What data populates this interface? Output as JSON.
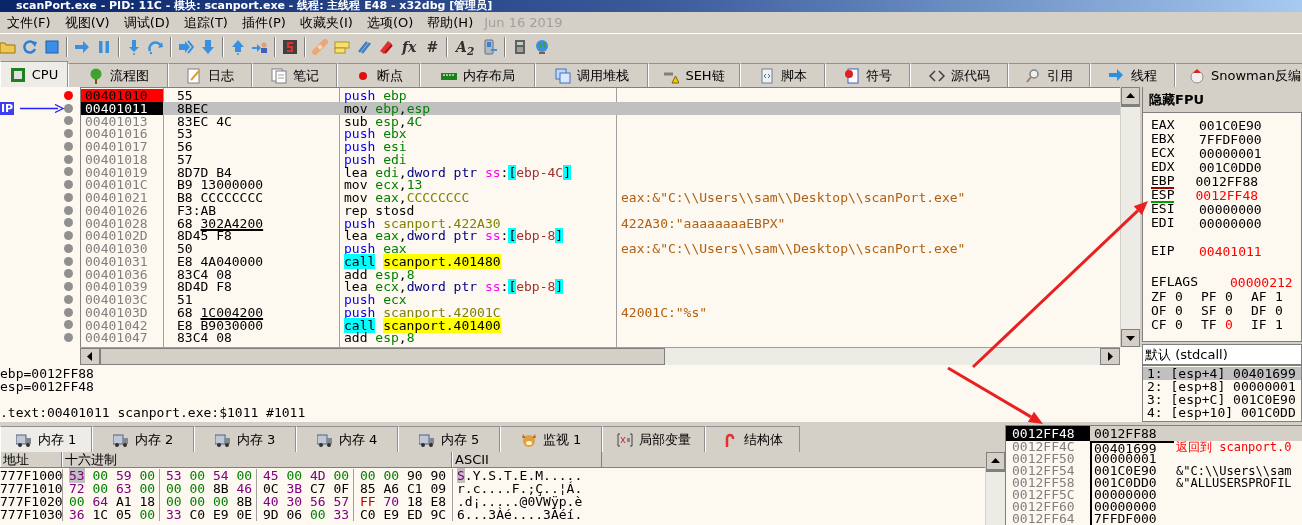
{
  "window": {
    "title": "scanPort.exe - PID: 11C - 模块: scanport.exe - 线程: 主线程 E48 - x32dbg [管理员]"
  },
  "menu": [
    "文件(F)",
    "视图(V)",
    "调试(D)",
    "追踪(T)",
    "插件(P)",
    "收藏夹(I)",
    "选项(O)",
    "帮助(H)"
  ],
  "build_date": "Jun 16 2019",
  "toolbar_glyphs": [
    "fx",
    "#",
    "A$_{2}$"
  ],
  "tabs": [
    {
      "label": "CPU",
      "selected": true
    },
    {
      "label": "流程图",
      "selected": false
    },
    {
      "label": "日志",
      "selected": false
    },
    {
      "label": "笔记",
      "selected": false
    },
    {
      "label": "断点",
      "selected": false
    },
    {
      "label": "内存布局",
      "selected": false
    },
    {
      "label": "调用堆栈",
      "selected": false
    },
    {
      "label": "SEH链",
      "selected": false
    },
    {
      "label": "脚本",
      "selected": false
    },
    {
      "label": "符号",
      "selected": false
    },
    {
      "label": "源代码",
      "selected": false
    },
    {
      "label": "引用",
      "selected": false
    },
    {
      "label": "线程",
      "selected": false
    },
    {
      "label": "Snowman反编",
      "selected": false
    }
  ],
  "disasm": {
    "eip_label": "IP",
    "rows": [
      {
        "address": "00401010",
        "bytes": "55",
        "fixup": false,
        "mnemonic": {
          "text": "push",
          "kind": "stack"
        },
        "operands": [
          {
            "text": "ebp",
            "kind": "reg"
          }
        ],
        "breakpoint": true,
        "current": false
      },
      {
        "address": "00401011",
        "bytes": "8BEC",
        "fixup": false,
        "mnemonic": {
          "text": "mov",
          "kind": "plain"
        },
        "operands": [
          {
            "text": "ebp",
            "kind": "reg"
          },
          {
            "text": ",",
            "kind": "sep"
          },
          {
            "text": "esp",
            "kind": "reg"
          }
        ],
        "breakpoint": false,
        "current": true
      },
      {
        "address": "00401013",
        "bytes": "83EC 4C",
        "fixup": false,
        "mnemonic": {
          "text": "sub",
          "kind": "plain"
        },
        "operands": [
          {
            "text": "esp",
            "kind": "reg"
          },
          {
            "text": ",",
            "kind": "sep"
          },
          {
            "text": "4C",
            "kind": "num"
          }
        ],
        "breakpoint": false,
        "current": false
      },
      {
        "address": "00401016",
        "bytes": "53",
        "fixup": false,
        "mnemonic": {
          "text": "push",
          "kind": "stack"
        },
        "operands": [
          {
            "text": "ebx",
            "kind": "reg"
          }
        ],
        "breakpoint": false,
        "current": false
      },
      {
        "address": "00401017",
        "bytes": "56",
        "fixup": false,
        "mnemonic": {
          "text": "push",
          "kind": "stack"
        },
        "operands": [
          {
            "text": "esi",
            "kind": "reg"
          }
        ],
        "breakpoint": false,
        "current": false
      },
      {
        "address": "00401018",
        "bytes": "57",
        "fixup": false,
        "mnemonic": {
          "text": "push",
          "kind": "stack"
        },
        "operands": [
          {
            "text": "edi",
            "kind": "reg"
          }
        ],
        "breakpoint": false,
        "current": false
      },
      {
        "address": "00401019",
        "bytes": "8D7D B4",
        "fixup": false,
        "mnemonic": {
          "text": "lea",
          "kind": "plain"
        },
        "operands": [
          {
            "text": "edi",
            "kind": "reg"
          },
          {
            "text": ",",
            "kind": "sep"
          },
          {
            "text": "dword ptr ",
            "kind": "size"
          },
          {
            "text": "ss",
            "kind": "seg"
          },
          {
            "text": ":",
            "kind": "sep"
          },
          {
            "text": "[",
            "kind": "bracket"
          },
          {
            "text": "ebp-4C",
            "kind": "mem"
          },
          {
            "text": "]",
            "kind": "bracket"
          }
        ],
        "breakpoint": false,
        "current": false
      },
      {
        "address": "0040101C",
        "bytes": "B9 13000000",
        "fixup": false,
        "mnemonic": {
          "text": "mov",
          "kind": "plain"
        },
        "operands": [
          {
            "text": "ecx",
            "kind": "reg"
          },
          {
            "text": ",",
            "kind": "sep"
          },
          {
            "text": "13",
            "kind": "num"
          }
        ],
        "breakpoint": false,
        "current": false
      },
      {
        "address": "00401021",
        "bytes": "B8 CCCCCCCC",
        "fixup": false,
        "mnemonic": {
          "text": "mov",
          "kind": "plain"
        },
        "operands": [
          {
            "text": "eax",
            "kind": "reg"
          },
          {
            "text": ",",
            "kind": "sep"
          },
          {
            "text": "CCCCCCCC",
            "kind": "addr"
          }
        ],
        "comment": "eax:&\"C:\\\\Users\\\\sam\\\\Desktop\\\\scanPort.exe\"",
        "breakpoint": false,
        "current": false
      },
      {
        "address": "00401026",
        "bytes": "F3:AB",
        "fixup": false,
        "mnemonic": {
          "text": "rep stosd",
          "kind": "plain"
        },
        "operands": [],
        "breakpoint": false,
        "current": false
      },
      {
        "address": "00401028",
        "bytes": "68 302A4200",
        "fixup": true,
        "mnemonic": {
          "text": "push",
          "kind": "stack"
        },
        "operands": [
          {
            "text": "scanport.422A30",
            "kind": "addr"
          }
        ],
        "comment": "422A30:\"aaaaaaaaEBPX\"",
        "breakpoint": false,
        "current": false
      },
      {
        "address": "0040102D",
        "bytes": "8D45 F8",
        "fixup": false,
        "mnemonic": {
          "text": "lea",
          "kind": "plain"
        },
        "operands": [
          {
            "text": "eax",
            "kind": "reg"
          },
          {
            "text": ",",
            "kind": "sep"
          },
          {
            "text": "dword ptr ",
            "kind": "size"
          },
          {
            "text": "ss",
            "kind": "seg"
          },
          {
            "text": ":",
            "kind": "sep"
          },
          {
            "text": "[",
            "kind": "bracket"
          },
          {
            "text": "ebp-8",
            "kind": "mem"
          },
          {
            "text": "]",
            "kind": "bracket"
          }
        ],
        "breakpoint": false,
        "current": false
      },
      {
        "address": "00401030",
        "bytes": "50",
        "fixup": false,
        "mnemonic": {
          "text": "push",
          "kind": "stack"
        },
        "operands": [
          {
            "text": "eax",
            "kind": "reg"
          }
        ],
        "comment": "eax:&\"C:\\\\Users\\\\sam\\\\Desktop\\\\scanPort.exe\"",
        "breakpoint": false,
        "current": false
      },
      {
        "address": "00401031",
        "bytes": "E8 4A040000",
        "fixup": false,
        "mnemonic": {
          "text": "call",
          "kind": "call"
        },
        "operands": [
          {
            "text": "scanport.401480",
            "kind": "target"
          }
        ],
        "breakpoint": false,
        "current": false
      },
      {
        "address": "00401036",
        "bytes": "83C4 08",
        "fixup": false,
        "mnemonic": {
          "text": "add",
          "kind": "plain"
        },
        "operands": [
          {
            "text": "esp",
            "kind": "reg"
          },
          {
            "text": ",",
            "kind": "sep"
          },
          {
            "text": "8",
            "kind": "num"
          }
        ],
        "breakpoint": false,
        "current": false
      },
      {
        "address": "00401039",
        "bytes": "8D4D F8",
        "fixup": false,
        "mnemonic": {
          "text": "lea",
          "kind": "plain"
        },
        "operands": [
          {
            "text": "ecx",
            "kind": "reg"
          },
          {
            "text": ",",
            "kind": "sep"
          },
          {
            "text": "dword ptr ",
            "kind": "size"
          },
          {
            "text": "ss",
            "kind": "seg"
          },
          {
            "text": ":",
            "kind": "sep"
          },
          {
            "text": "[",
            "kind": "bracket"
          },
          {
            "text": "ebp-8",
            "kind": "mem"
          },
          {
            "text": "]",
            "kind": "bracket"
          }
        ],
        "breakpoint": false,
        "current": false
      },
      {
        "address": "0040103C",
        "bytes": "51",
        "fixup": false,
        "mnemonic": {
          "text": "push",
          "kind": "stack"
        },
        "operands": [
          {
            "text": "ecx",
            "kind": "reg"
          }
        ],
        "breakpoint": false,
        "current": false
      },
      {
        "address": "0040103D",
        "bytes": "68 1C004200",
        "fixup": true,
        "mnemonic": {
          "text": "push",
          "kind": "stack"
        },
        "operands": [
          {
            "text": "scanport.42001C",
            "kind": "addr"
          }
        ],
        "comment": "42001C:\"%s\"",
        "breakpoint": false,
        "current": false
      },
      {
        "address": "00401042",
        "bytes": "E8 B9030000",
        "fixup": false,
        "mnemonic": {
          "text": "call",
          "kind": "call"
        },
        "operands": [
          {
            "text": "scanport.401400",
            "kind": "target"
          }
        ],
        "breakpoint": false,
        "current": false
      },
      {
        "address": "00401047",
        "bytes": "83C4 08",
        "fixup": false,
        "mnemonic": {
          "text": "add",
          "kind": "plain"
        },
        "operands": [
          {
            "text": "esp",
            "kind": "reg"
          },
          {
            "text": ",",
            "kind": "sep"
          },
          {
            "text": "8",
            "kind": "num"
          }
        ],
        "breakpoint": false,
        "current": false
      }
    ]
  },
  "registers": {
    "toggle_button": "隐藏FPU",
    "general": [
      {
        "name": "EAX",
        "value": "001C0E90",
        "changed": false
      },
      {
        "name": "EBX",
        "value": "7FFDF000",
        "changed": false
      },
      {
        "name": "ECX",
        "value": "00000001",
        "changed": false
      },
      {
        "name": "EDX",
        "value": "001C0DD0",
        "changed": false
      },
      {
        "name": "EBP",
        "value": "0012FF88",
        "changed": false,
        "color": "#a00000"
      },
      {
        "name": "ESP",
        "value": "0012FF48",
        "changed": true,
        "color": "#00a000"
      },
      {
        "name": "ESI",
        "value": "00000000",
        "changed": false
      },
      {
        "name": "EDI",
        "value": "00000000",
        "changed": false
      }
    ],
    "eip": {
      "name": "EIP",
      "value": "00401011",
      "changed": true
    },
    "eflags": {
      "name": "EFLAGS",
      "value": "00000212",
      "changed": true
    },
    "flags": [
      {
        "name": "ZF",
        "value": "0",
        "changed": false
      },
      {
        "name": "PF",
        "value": "0",
        "changed": false
      },
      {
        "name": "AF",
        "value": "1",
        "changed": false
      },
      {
        "name": "OF",
        "value": "0",
        "changed": false
      },
      {
        "name": "SF",
        "value": "0",
        "changed": false
      },
      {
        "name": "DF",
        "value": "0",
        "changed": false
      },
      {
        "name": "CF",
        "value": "0",
        "changed": false
      },
      {
        "name": "TF",
        "value": "0",
        "changed": true
      },
      {
        "name": "IF",
        "value": "1",
        "changed": false
      }
    ]
  },
  "calling_convention": "默认 (stdcall)",
  "stack_args": [
    {
      "text": "1: [esp+4] 00401699",
      "selected": true
    },
    {
      "text": "2: [esp+8] 00000001",
      "selected": false
    },
    {
      "text": "3: [esp+C] 001C0E90",
      "selected": false
    },
    {
      "text": "4: [esp+10] 001C0DD",
      "selected": false
    }
  ],
  "info": {
    "values": [
      "ebp=0012FF88",
      "esp=0012FF48"
    ],
    "location": ".text:00401011 scanport.exe:$1011 #1011"
  },
  "memory_tabs": [
    {
      "label": "内存 1",
      "selected": true
    },
    {
      "label": "内存 2",
      "selected": false
    },
    {
      "label": "内存 3",
      "selected": false
    },
    {
      "label": "内存 4",
      "selected": false
    },
    {
      "label": "内存 5",
      "selected": false
    },
    {
      "label": "监视 1",
      "selected": false
    },
    {
      "label": "局部变量",
      "selected": false
    },
    {
      "label": "结构体",
      "selected": false
    }
  ],
  "dump": {
    "columns": [
      "地址",
      "十六进制",
      "ASCII"
    ],
    "rows": [
      {
        "address": "777F1000",
        "bytes": "53 00 59 00 53 00 54 00 45 00 4D 00 00 00 90 90",
        "ascii": "S.Y.S.T.E.M.....",
        "selected": true
      },
      {
        "address": "777F1010",
        "bytes": "72 00 63 00 00 00 8B 46 0C 3B C7 0F 85 A6 C1 09",
        "ascii": "r.c....F.;Ç..¦Á.",
        "selected": false
      },
      {
        "address": "777F1020",
        "bytes": "00 64 A1 18 00 00 00 8B 40 30 56 57 FF 70 18 E8",
        "ascii": ".d¡.....@0VWÿp.è",
        "selected": false
      },
      {
        "address": "777F1030",
        "bytes": "36 1C 05 00 33 C0 E9 0E 9D 06 00 33 C0 E9 ED 9C",
        "ascii": "6...3Àé....3Àéí.",
        "selected": false
      }
    ]
  },
  "stack": {
    "top": {
      "address": "0012FF48",
      "value": "0012FF88"
    },
    "rows": [
      {
        "address": "0012FF4C",
        "value": "00401699",
        "comment": {
          "text": "返回到 scanport.0",
          "kind": "return"
        }
      },
      {
        "address": "0012FF50",
        "value": "00000001"
      },
      {
        "address": "0012FF54",
        "value": "001C0E90",
        "comment": {
          "text": "&\"C:\\\\Users\\\\sam",
          "kind": "string"
        }
      },
      {
        "address": "0012FF58",
        "value": "001C0DD0",
        "comment": {
          "text": "&\"ALLUSERSPROFIL",
          "kind": "string"
        }
      },
      {
        "address": "0012FF5C",
        "value": "00000000"
      },
      {
        "address": "0012FF60",
        "value": "00000000"
      },
      {
        "address": "0012FF64",
        "value": "7FFDF000"
      }
    ]
  }
}
